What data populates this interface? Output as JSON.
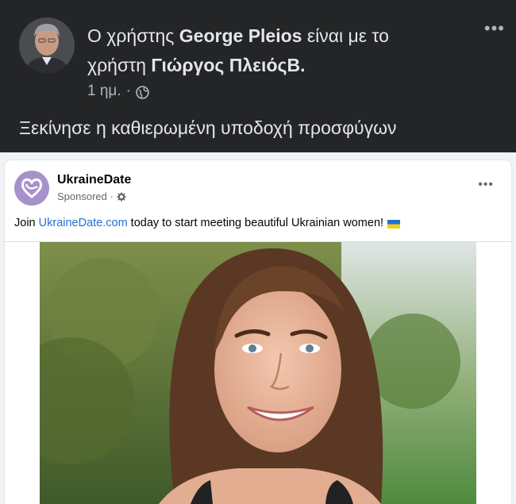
{
  "outer_post": {
    "header_prefix": "Ο χρήστης",
    "author_name": "George Pleios",
    "header_middle": "είναι με το",
    "tag_prefix": "χρήστη",
    "tagged_name": "Γιώργος ΠλειόςΒ.",
    "timestamp": "1 ημ.",
    "separator": "·",
    "audience_icon": "globe-icon",
    "more_icon": "•••",
    "text": "Ξεκίνησε η καθιερωμένη υποδοχή προσφύγων"
  },
  "shared_post": {
    "page_name": "UkraineDate",
    "sponsored_label": "Sponsored ·",
    "privacy_icon": "gear-icon",
    "more_icon": "•••",
    "text_before_link": "Join ",
    "link_text": "UkraineDate.com",
    "text_after_link": " today to start meeting beautiful Ukrainian women!",
    "flag_icon": "ukraine-flag-icon"
  },
  "colors": {
    "dark_bg": "#242526",
    "primary_text_dark": "#e4e6eb",
    "secondary_text_dark": "#b0b3b8",
    "link": "#216fdb",
    "page_avatar": "#a692c9"
  }
}
